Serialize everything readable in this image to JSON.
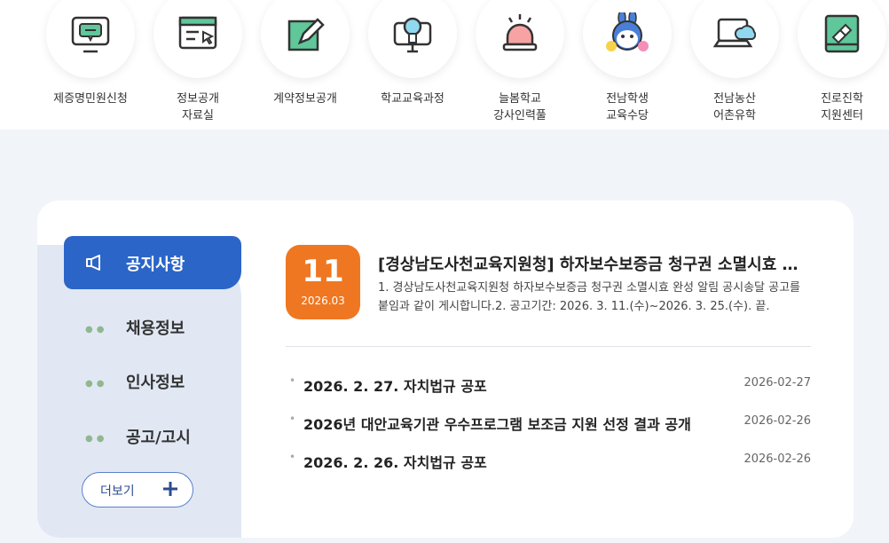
{
  "quick_links": [
    {
      "label": "제증명민원신청",
      "icon": "monitor-chat-icon"
    },
    {
      "label": "정보공개\n자료실",
      "icon": "window-cursor-icon"
    },
    {
      "label": "계약정보공개",
      "icon": "pencil-paper-icon"
    },
    {
      "label": "학교교육과정",
      "icon": "lightbulb-monitor-icon"
    },
    {
      "label": "늘봄학교\n강사인력풀",
      "icon": "siren-icon"
    },
    {
      "label": "전남학생\n교육수당",
      "icon": "mascot-character-icon"
    },
    {
      "label": "전남농산\n어촌유학",
      "icon": "laptop-cloud-icon"
    },
    {
      "label": "진로진학\n지원센터",
      "icon": "book-eraser-icon"
    }
  ],
  "tabs": {
    "notice": "공지사항",
    "recruit": "채용정보",
    "personnel": "인사정보",
    "announcement": "공고/고시",
    "more": "더보기"
  },
  "featured": {
    "day": "11",
    "month": "2026.03",
    "title": "[경상남도사천교육지원청] 하자보수보증금 청구권 소멸시효 완성 알림 공시송달 공고",
    "body": "1. 경상남도사천교육지원청 하자보수보증금 청구권 소멸시효 완성 알림 공시송달 공고를 붙임과 같이 게시합니다.2. 공고기간: 2026. 3. 11.(수)~2026. 3. 25.(수). 끝."
  },
  "posts": [
    {
      "title": "2026. 2. 27. 자치법규 공포",
      "date": "2026-02-27"
    },
    {
      "title": "2026년 대안교육기관 우수프로그램 보조금 지원 선정 결과 공개",
      "date": "2026-02-26"
    },
    {
      "title": "2026. 2. 26. 자치법규 공포",
      "date": "2026-02-26"
    }
  ],
  "colors": {
    "accent": "#2b65c8",
    "date_badge": "#ef7722",
    "icon_green": "#5fc79a"
  }
}
